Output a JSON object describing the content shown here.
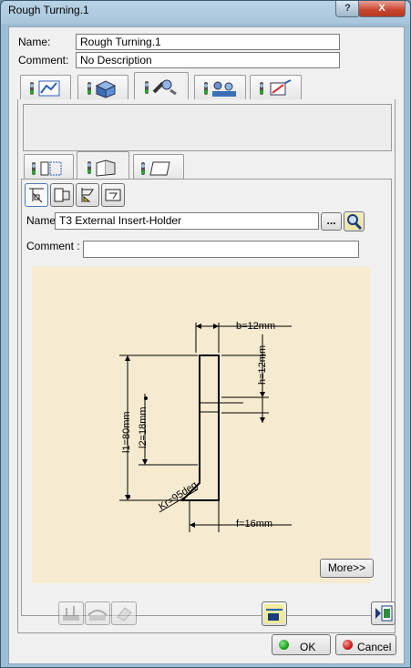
{
  "window": {
    "title": "Rough Turning.1",
    "help_glyph": "?",
    "close_glyph": "X"
  },
  "form": {
    "name_label": "Name:",
    "name_value": "Rough Turning.1",
    "comment_label": "Comment:",
    "comment_value": "No Description"
  },
  "main_tabs": [
    {
      "icon": "strategy-parameters-icon"
    },
    {
      "icon": "geometry-icon"
    },
    {
      "icon": "tool-icon",
      "active": true
    },
    {
      "icon": "feeds-speeds-icon"
    },
    {
      "icon": "macro-icon"
    }
  ],
  "sub_tabs": [
    {
      "icon": "tool-assembly-icon"
    },
    {
      "icon": "insert-holder-icon",
      "active": true
    },
    {
      "icon": "insert-icon"
    }
  ],
  "tool": {
    "name_label": "Name",
    "name_value": "T3 External Insert-Holder",
    "browse_label": "...",
    "comment_label": "Comment :",
    "comment_value": ""
  },
  "drawing": {
    "b": "b=12mm",
    "h": "h=12mm",
    "l1": "l1=80mm",
    "l2": "l2=18mm",
    "kr": "Kr=95deg",
    "f": "f=16mm"
  },
  "more_label": "More>>",
  "ok_label": "OK",
  "cancel_label": "Cancel",
  "colors": {
    "ok_dot": "#1fa81f",
    "cancel_dot": "#d21b1b",
    "drawing_bg": "#f6ead0"
  }
}
